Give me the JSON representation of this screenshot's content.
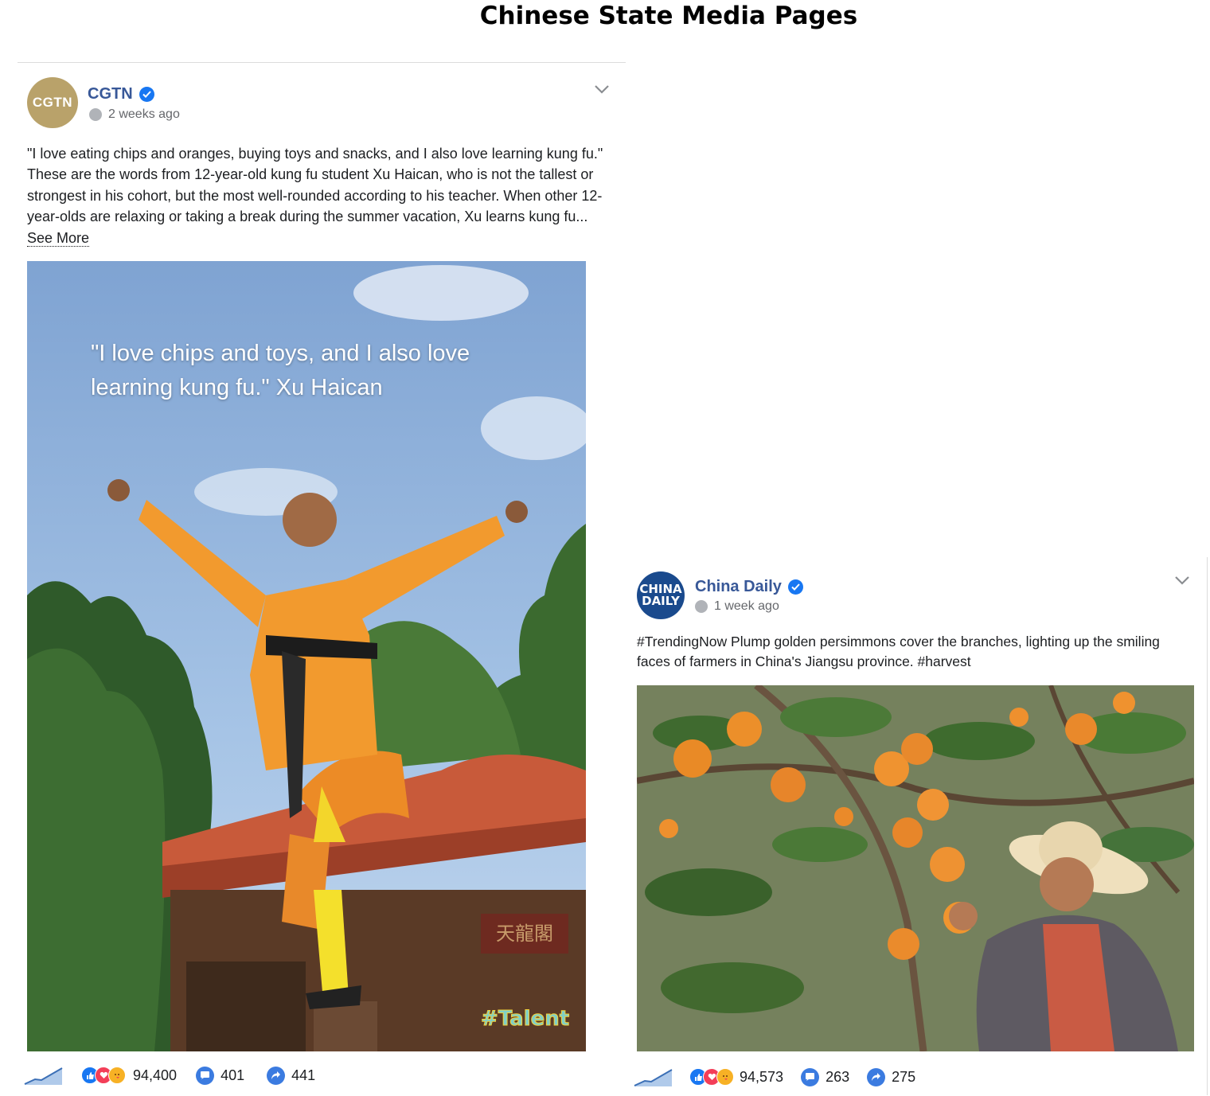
{
  "page": {
    "title": "Chinese State Media Pages"
  },
  "posts": [
    {
      "page_name": "CGTN",
      "avatar_text": "CGTN",
      "time": "2 weeks ago",
      "text": "\"I love eating chips and oranges, buying toys and snacks, and I also love learning kung fu.\" These are the words from 12-year-old kung fu student Xu Haican, who is not the tallest or strongest in his cohort, but the most well-rounded according to his teacher. When other 12-year-olds are relaxing or taking a break during the summer vacation, Xu learns kung fu...",
      "see_more": "See More",
      "image": {
        "overlay_quote": "\"I love chips and toys, and I also love learning kung fu.\" Xu Haican",
        "sign_text": "天龍閣",
        "sticker_text": "#Talent"
      },
      "reactions": "94,400",
      "comments": "401",
      "shares": "441"
    },
    {
      "page_name": "China Daily",
      "avatar_text": [
        "CHINA",
        "DAILY"
      ],
      "time": "1 week ago",
      "text": "#TrendingNow Plump golden persimmons cover the branches, lighting up the smiling faces of farmers in China's Jiangsu province. #harvest",
      "reactions": "94,573",
      "comments": "263",
      "shares": "275"
    }
  ],
  "icons": [
    "verified-badge-icon",
    "globe-icon",
    "chevron-down-icon",
    "trend-graph-icon",
    "like-reaction-icon",
    "love-reaction-icon",
    "care-reaction-icon",
    "comment-icon",
    "share-icon"
  ],
  "colors": {
    "page_name": "#385898",
    "verified": "#1877f2",
    "meta": "#65676b",
    "cgtn_gold": "#b9a26a",
    "china_daily_blue": "#1a4a8d",
    "robe_orange": "#f0962e",
    "sky": "#8fb3dc"
  }
}
